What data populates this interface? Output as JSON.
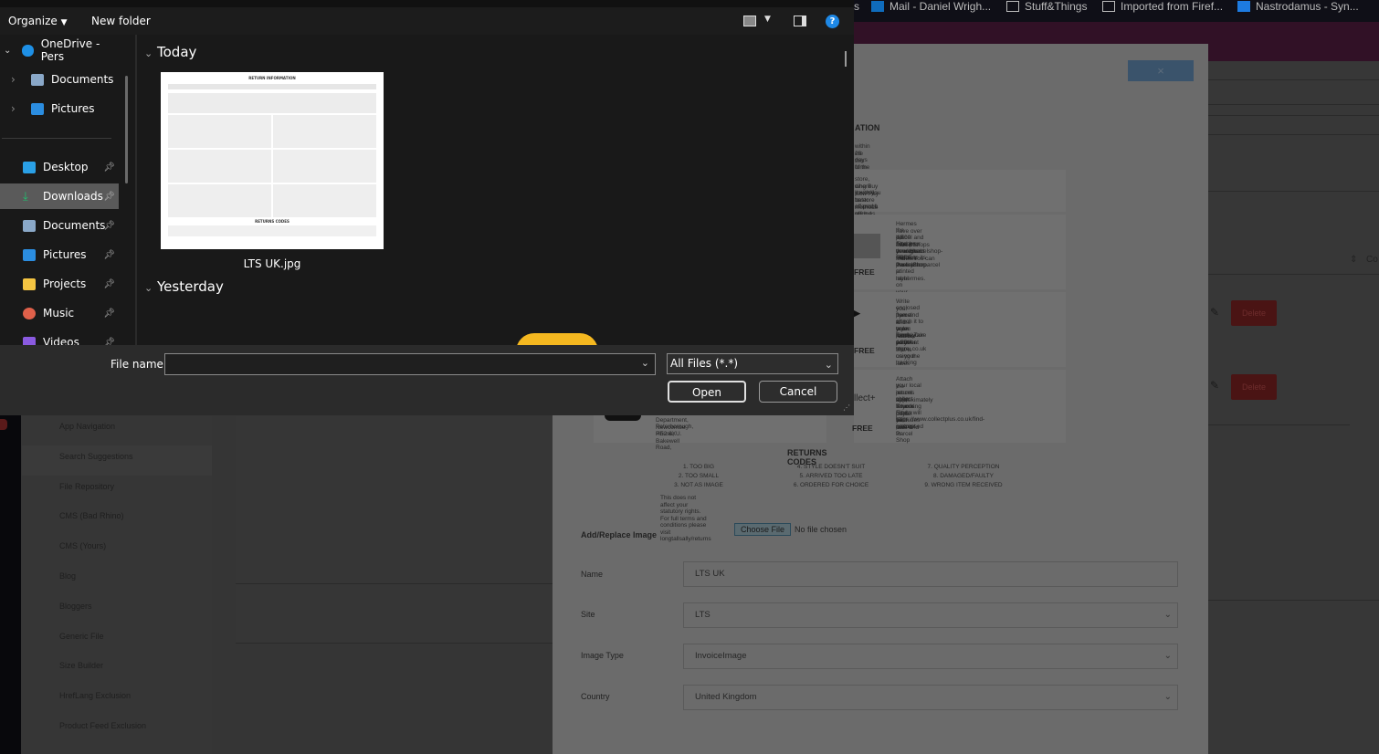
{
  "browser": {
    "bookmarks": [
      {
        "label": "s",
        "icon": "none"
      },
      {
        "label": "Mail - Daniel Wrigh...",
        "icon": "outlook-icon"
      },
      {
        "label": "Stuff&Things",
        "icon": "folder-icon"
      },
      {
        "label": "Imported from Firef...",
        "icon": "folder-icon"
      },
      {
        "label": "Nastrodamus - Syn...",
        "icon": "dsm-icon"
      }
    ]
  },
  "sidebar": {
    "items": [
      "App Navigation",
      "Search Suggestions",
      "File Repository",
      "CMS (Bad Rhino)",
      "CMS (Yours)",
      "Blog",
      "Bloggers",
      "Generic File",
      "Size Builder",
      "HrefLang Exclusion",
      "Product Feed Exclusion"
    ],
    "active": "File Repository"
  },
  "modal": {
    "close_label": "×",
    "image": {
      "heading": "ATION",
      "intro": [
        "within 28 days of the invoice date.",
        "ete this form and pop it into your parcel."
      ],
      "store_text": [
        "store, where you will be offered a refund. You will be refunded",
        "ding Buy Now Pay Later methods such as Klarna, Clearpay and",
        "il with you to store as proof of purchase. Find your nearest store"
      ],
      "hermes_text": [
        "Hermes have over 4,500 ParcelShops throughout",
        "the UK. Attach your FREE pre-printed label on your",
        "parcel and take it to your local Hermes ParcelShop.",
        "Find your nearest Hermes ParcelShop at myhermes.",
        "co.uk/parcelshop-finder. You can track your parcel",
        "online to its destination."
      ],
      "asda_text": [
        "Write your name and order number on your",
        "enclosed flyer and attach it to your parcel.Take your",
        "parcel to the toyou returns point",
        "at your local ASDA store.",
        "",
        "Track your parcel at toyou.co.uk using the tracking",
        "number that is on your label."
      ],
      "collect_text": [
        "Attach the returns label to your parcel and take it to",
        "your local parcel shop. Your return will be processed",
        "in approximately 7 working days.  Excludes click and",
        "collect returns.",
        "",
        "Find your nearest Parcel Shop",
        "https://www.collectplus.co.uk/find-a-store"
      ],
      "postoffice_text": [
        "Department, Newcombe House, Bakewell Road,",
        "Peterborough, PE2 6XU."
      ],
      "free": "FREE",
      "codes_title": "RETURNS CODES",
      "codes": [
        [
          "1. TOO BIG",
          "2. TOO SMALL",
          "3. NOT AS IMAGE"
        ],
        [
          "4. STYLE DOESN'T SUIT",
          "5. ARRIVED TOO LATE",
          "6. ORDERED FOR CHOICE"
        ],
        [
          "7. QUALITY PERCEPTION",
          "8. DAMAGED/FAULTY",
          "9. WRONG ITEM RECEIVED"
        ]
      ],
      "footer": "This does not affect your statutory rights. For full terms and conditions please visit longtallsally/returns"
    },
    "add_replace_label": "Add/Replace Image",
    "choose_file": "Choose File",
    "no_file": "No file chosen",
    "fields": [
      {
        "label": "Name",
        "value": "LTS UK",
        "type": "text"
      },
      {
        "label": "Site",
        "value": "LTS",
        "type": "select"
      },
      {
        "label": "Image Type",
        "value": "InvoiceImage",
        "type": "select"
      },
      {
        "label": "Country",
        "value": "United Kingdom",
        "type": "select"
      }
    ]
  },
  "right_pane": {
    "column_partial": "Co",
    "delete_label": "Delete"
  },
  "dialog": {
    "toolbar": {
      "organize": "Organize",
      "new_folder": "New folder"
    },
    "nav": [
      {
        "label": "OneDrive - Pers",
        "icon": "onedrive-icon",
        "expanded": true
      },
      {
        "label": "Documents",
        "icon": "documents-icon"
      },
      {
        "label": "Pictures",
        "icon": "pictures-icon"
      },
      {
        "label": "Desktop",
        "icon": "desktop-icon",
        "pinned": true
      },
      {
        "label": "Downloads",
        "icon": "downloads-icon",
        "pinned": true,
        "selected": true
      },
      {
        "label": "Documents",
        "icon": "documents-icon",
        "pinned": true
      },
      {
        "label": "Pictures",
        "icon": "pictures-icon",
        "pinned": true
      },
      {
        "label": "Projects",
        "icon": "folder-icon",
        "pinned": true
      },
      {
        "label": "Music",
        "icon": "music-icon",
        "pinned": true
      },
      {
        "label": "Videos",
        "icon": "videos-icon",
        "pinned": true
      }
    ],
    "groups": [
      "Today",
      "Yesterday"
    ],
    "files": [
      {
        "name": "LTS UK.jpg",
        "thumb_title": "RETURN INFORMATION",
        "thumb_codes": "RETURNS CODES"
      }
    ],
    "file_name_label": "File name:",
    "file_name_value": "",
    "file_type": "All Files (*.*)",
    "open": "Open",
    "cancel": "Cancel",
    "colors": {
      "accent": "#0078d4",
      "selected": "#5a5a5a"
    }
  }
}
